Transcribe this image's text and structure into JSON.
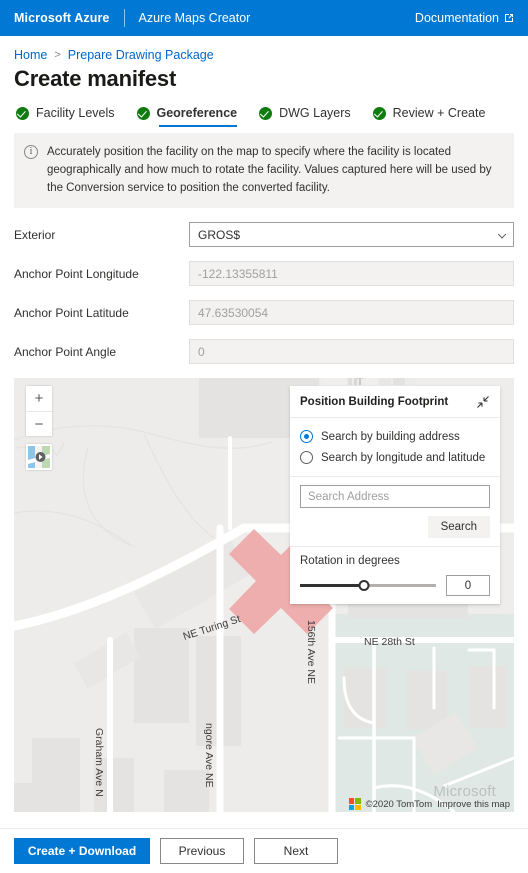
{
  "topbar": {
    "brand": "Microsoft Azure",
    "product": "Azure Maps Creator",
    "documentation": "Documentation",
    "documentation_icon": "external-link-icon",
    "bg_color": "#0078d4"
  },
  "breadcrumb": {
    "items": [
      "Home",
      "Prepare Drawing Package"
    ],
    "separator": ">"
  },
  "page_title": "Create manifest",
  "tabs": [
    {
      "label": "Facility Levels",
      "state": "complete",
      "active": false,
      "icon": "check-circle-icon"
    },
    {
      "label": "Georeference",
      "state": "complete",
      "active": true,
      "icon": "check-circle-icon"
    },
    {
      "label": "DWG Layers",
      "state": "complete",
      "active": false,
      "icon": "check-circle-icon"
    },
    {
      "label": "Review + Create",
      "state": "complete",
      "active": false,
      "icon": "check-circle-icon"
    }
  ],
  "info_banner": {
    "icon": "info-icon",
    "text": "Accurately position the facility on the map to specify where the facility is located geographically and how much to rotate the facility. Values captured here will be used by the Conversion service to position the converted facility."
  },
  "form": {
    "exterior": {
      "label": "Exterior",
      "value": "GROS$",
      "icon": "chevron-down-icon"
    },
    "longitude": {
      "label": "Anchor Point Longitude",
      "value": "-122.13355811"
    },
    "latitude": {
      "label": "Anchor Point Latitude",
      "value": "47.63530054"
    },
    "angle": {
      "label": "Anchor Point Angle",
      "value": "0"
    }
  },
  "map": {
    "zoom_in": "+",
    "zoom_out": "−",
    "style_button_icon": "map-style-icon",
    "compass_icon": "compass-icon",
    "labels": [
      "NE Turing St",
      "NE 28th St",
      "156th Ave NE",
      "Graham Ave N",
      "ngore Ave NE"
    ],
    "footprint_color": "#efaeae",
    "attribution": "©2020 TomTom",
    "improve_link": "Improve this map",
    "watermark": "Microsoft",
    "logo_colors": [
      "#f25022",
      "#7fba00",
      "#00a4ef",
      "#ffb900"
    ]
  },
  "panel": {
    "title": "Position Building Footprint",
    "collapse_icon": "collapse-diagonal-icon",
    "options": [
      {
        "label": "Search by building address",
        "selected": true
      },
      {
        "label": "Search by longitude and latitude",
        "selected": false
      }
    ],
    "search_placeholder": "Search Address",
    "search_value": "",
    "search_button": "Search",
    "rotation_label": "Rotation in degrees",
    "rotation_value": "0",
    "rotation_percent": 47
  },
  "footer": {
    "create": "Create + Download",
    "previous": "Previous",
    "next": "Next",
    "primary_color": "#0078d4"
  }
}
